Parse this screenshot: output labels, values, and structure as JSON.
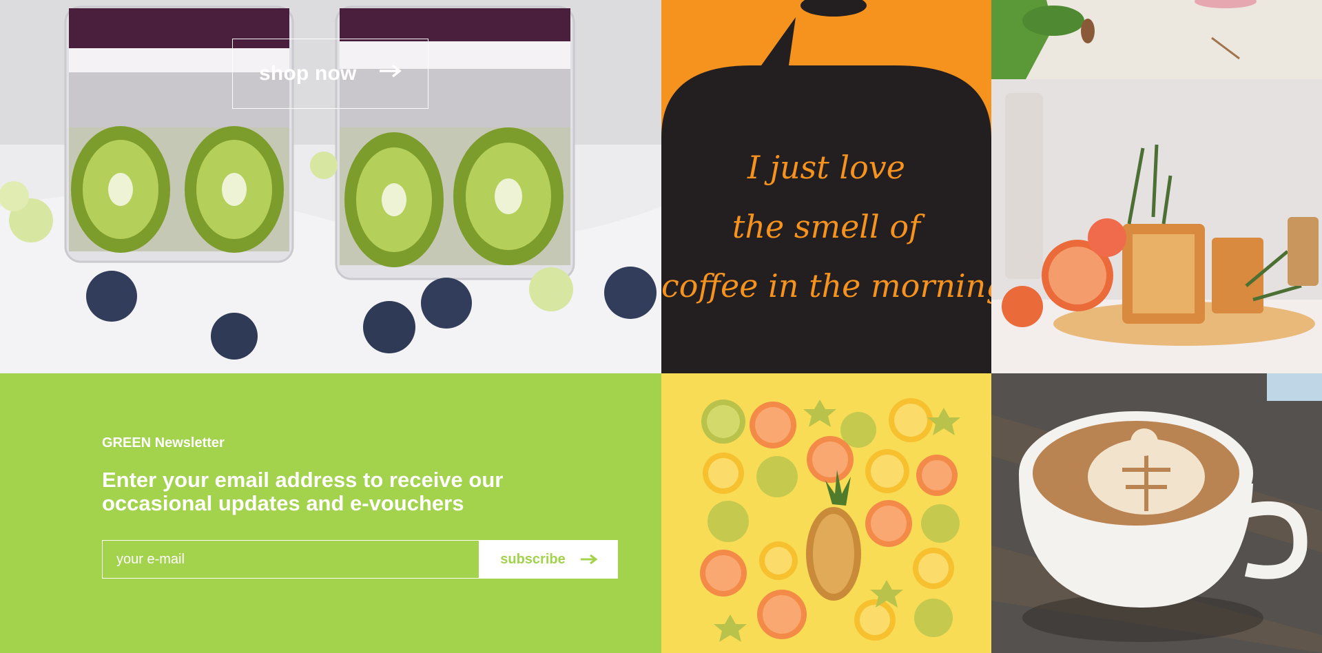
{
  "hero": {
    "shop_label": "shop now",
    "arrow_icon": "arrow-right-icon"
  },
  "quote": {
    "lines": [
      "I just love",
      "the smell of",
      "coffee in the morning"
    ],
    "bubble_color": "#231f20",
    "background_color": "#f6921e",
    "text_color": "#f6921e"
  },
  "newsletter": {
    "kicker": "GREEN Newsletter",
    "heading": "Enter your email address to receive our occasional updates and e-vouchers",
    "email_placeholder": "your e-mail",
    "email_value": "",
    "subscribe_label": "subscribe",
    "arrow_icon": "arrow-right-icon",
    "background_color": "#a3d24c"
  },
  "colors": {
    "accent_green": "#a3d24c",
    "accent_orange": "#f6921e",
    "dark": "#231f20"
  }
}
